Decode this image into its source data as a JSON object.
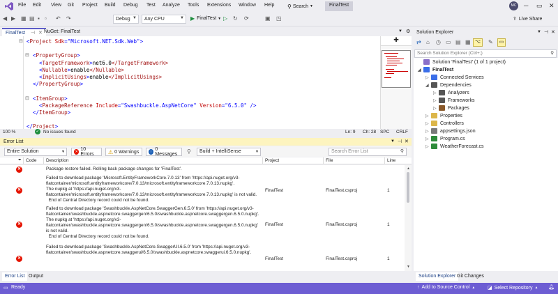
{
  "menu": {
    "items": [
      "File",
      "Edit",
      "View",
      "Git",
      "Project",
      "Build",
      "Debug",
      "Test",
      "Analyze",
      "Tools",
      "Extensions",
      "Window",
      "Help"
    ],
    "search_label": "Search",
    "solution_name": "FinalTest",
    "avatar_initials": "MC"
  },
  "toolbar": {
    "config": "Debug",
    "platform": "Any CPU",
    "run_target": "FinalTest",
    "live_share": "Live Share"
  },
  "editor": {
    "tabs": [
      {
        "label": "FinalTest",
        "active": true
      },
      {
        "label": "NuGet: FinalTest",
        "active": false
      }
    ],
    "zoom": "100 %",
    "issues": "No issues found",
    "position": {
      "ln": "Ln: 9",
      "ch": "Ch: 28",
      "encoding": "SPC",
      "eol": "CRLF"
    },
    "lines": [
      {
        "indent": 0,
        "open": "<",
        "tag": "Project",
        "attrs": [
          {
            "name": "Sdk",
            "value": "\"Microsoft.NET.Sdk.Web\""
          }
        ],
        "close": ">"
      },
      {
        "blank": true
      },
      {
        "indent": 1,
        "open": "<",
        "tag": "PropertyGroup",
        "close": ">"
      },
      {
        "indent": 2,
        "open": "<",
        "tag": "TargetFramework",
        "close": ">",
        "text": "net6.0",
        "end": "</TargetFramework>"
      },
      {
        "indent": 2,
        "open": "<",
        "tag": "Nullable",
        "close": ">",
        "text": "enable",
        "end": "</Nullable>"
      },
      {
        "indent": 2,
        "open": "<",
        "tag": "ImplicitUsings",
        "close": ">",
        "text": "enable",
        "end": "</ImplicitUsings>"
      },
      {
        "indent": 1,
        "open": "</",
        "tag": "PropertyGroup",
        "close": ">"
      },
      {
        "blank": true
      },
      {
        "indent": 1,
        "open": "<",
        "tag": "ItemGroup",
        "close": ">"
      },
      {
        "indent": 2,
        "open": "<",
        "tag": "PackageReference",
        "attrs": [
          {
            "name": "Include",
            "value": "\"Swashbuckle.AspNetCore\""
          },
          {
            "name": "Version",
            "value": "\"6.5.0\""
          }
        ],
        "close": " />"
      },
      {
        "indent": 1,
        "open": "</",
        "tag": "ItemGroup",
        "close": ">"
      },
      {
        "blank": true
      },
      {
        "indent": 0,
        "open": "</",
        "tag": "Project",
        "close": ">"
      }
    ]
  },
  "error_list": {
    "title": "Error List",
    "scope": "Entire Solution",
    "errors_btn": "10 Errors",
    "warnings_btn": "0 Warnings",
    "messages_btn": "0 Messages",
    "build_filter": "Build + IntelliSense",
    "search_placeholder": "Search Error List",
    "columns": [
      "Code",
      "Description",
      "Project",
      "File",
      "Line"
    ],
    "rows": [
      {
        "description": "Package restore failed. Rolling back package changes for 'FinalTest'.",
        "project": "",
        "file": "",
        "line": ""
      },
      {
        "description": "Failed to download package 'Microsoft.EntityFrameworkCore.7.0.13' from 'https://api.nuget.org/v3-flatcontainer/microsoft.entityframeworkcore/7.0.13/microsoft.entityframeworkcore.7.0.13.nupkg'.\nThe nupkg at 'https://api.nuget.org/v3-flatcontainer/microsoft.entityframeworkcore/7.0.13/microsoft.entityframeworkcore.7.0.13.nupkg' is not valid.\n  End of Central Directory record could not be found.",
        "project": "FinalTest",
        "file": "FinalTest.csproj",
        "line": "1"
      },
      {
        "description": "Failed to download package 'Swashbuckle.AspNetCore.SwaggerGen.6.5.0' from 'https://api.nuget.org/v3-flatcontainer/swashbuckle.aspnetcore.swaggergen/6.5.0/swashbuckle.aspnetcore.swaggergen.6.5.0.nupkg'.\nThe nupkg at 'https://api.nuget.org/v3-flatcontainer/swashbuckle.aspnetcore.swaggergen/6.5.0/swashbuckle.aspnetcore.swaggergen.6.5.0.nupkg' is not valid.\n  End of Central Directory record could not be found.",
        "project": "FinalTest",
        "file": "FinalTest.csproj",
        "line": "1"
      },
      {
        "description": "Failed to download package 'Swashbuckle.AspNetCore.SwaggerUI.6.5.0' from 'https://api.nuget.org/v3-flatcontainer/swashbuckle.aspnetcore.swaggerui/6.5.0/swashbuckle.aspnetcore.swaggerui.6.5.0.nupkg'.",
        "project": "FinalTest",
        "file": "FinalTest.csproj",
        "line": "1"
      }
    ],
    "bottom_tabs": [
      "Error List",
      "Output"
    ]
  },
  "solution_explorer": {
    "title": "Solution Explorer",
    "search_placeholder": "Search Solution Explorer (Ctrl+;)",
    "tree": [
      {
        "label": "Solution 'FinalTest' (1 of 1 project)",
        "depth": 0,
        "chevron": "",
        "color": "#8a6fc9",
        "bold": false
      },
      {
        "label": "FinalTest",
        "depth": 0,
        "chevron": "◢",
        "color": "#3a6ee8",
        "bold": true
      },
      {
        "label": "Connected Services",
        "depth": 1,
        "chevron": "▷",
        "color": "#3a6ee8",
        "bold": false
      },
      {
        "label": "Dependencies",
        "depth": 1,
        "chevron": "◢",
        "color": "#555555",
        "bold": false
      },
      {
        "label": "Analyzers",
        "depth": 2,
        "chevron": "▷",
        "color": "#555555",
        "bold": false
      },
      {
        "label": "Frameworks",
        "depth": 2,
        "chevron": "▷",
        "color": "#555555",
        "bold": false
      },
      {
        "label": "Packages",
        "depth": 2,
        "chevron": "▷",
        "color": "#8a5a2b",
        "bold": false
      },
      {
        "label": "Properties",
        "depth": 1,
        "chevron": "▷",
        "color": "#dcb64a",
        "bold": false
      },
      {
        "label": "Controllers",
        "depth": 1,
        "chevron": "▷",
        "color": "#dcb64a",
        "bold": false
      },
      {
        "label": "appsettings.json",
        "depth": 1,
        "chevron": "▷",
        "color": "#7a7a7a",
        "bold": false
      },
      {
        "label": "Program.cs",
        "depth": 1,
        "chevron": "▷",
        "color": "#2e8b3a",
        "bold": false
      },
      {
        "label": "WeatherForecast.cs",
        "depth": 1,
        "chevron": "▷",
        "color": "#2e8b3a",
        "bold": false
      }
    ],
    "bottom_tabs": [
      "Solution Explorer",
      "Git Changes"
    ]
  },
  "statusbar": {
    "ready": "Ready",
    "source_control": "Add to Source Control",
    "repository": "Select Repository"
  },
  "colors": {
    "accent": "#6d5dd3",
    "error": "#e51400",
    "warning": "#f1c40f"
  }
}
